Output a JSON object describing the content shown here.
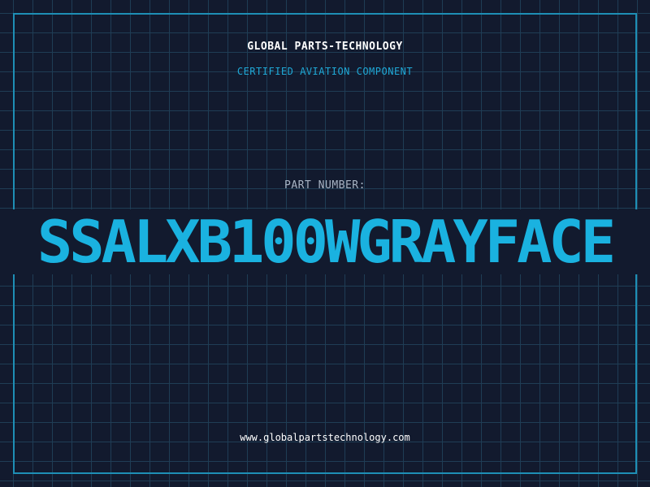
{
  "header": {
    "company": "GLOBAL PARTS-TECHNOLOGY",
    "subtitle": "CERTIFIED AVIATION COMPONENT"
  },
  "part": {
    "label": "PART NUMBER:",
    "number": "SSALXB100WGRAYFACE"
  },
  "footer": {
    "url": "www.globalpartstechnology.com"
  },
  "colors": {
    "background": "#121a2e",
    "grid": "#1f3d55",
    "frame": "#1e8fb5",
    "accent": "#1ab2e0",
    "label": "#a8b4c4"
  }
}
